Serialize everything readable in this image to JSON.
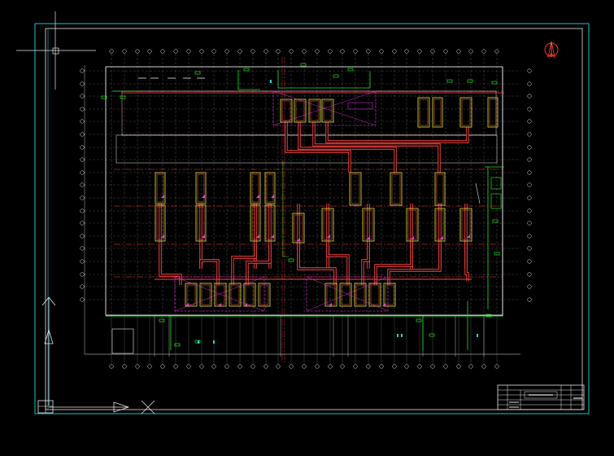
{
  "drawing": {
    "background": "#000000",
    "colors": {
      "frame": "#19c8c8",
      "wall": "#e8e8e8",
      "grid_axis": "#ff3c3c",
      "duct": "#ff4444",
      "equipment": "#e8e04a",
      "pipe_green": "#22e022",
      "magenta": "#ff33ff",
      "axis_bubble": "#e8e8e8",
      "text_cyan": "#20d8d8",
      "north": "#ff3030"
    },
    "icons": {
      "north_arrow": "north-arrow-icon",
      "ucs": "ucs-axis-icon",
      "crosshair": "crosshair-icon"
    }
  },
  "title_block": {
    "rows": [
      "",
      "",
      "",
      "",
      ""
    ],
    "stamp": ""
  }
}
